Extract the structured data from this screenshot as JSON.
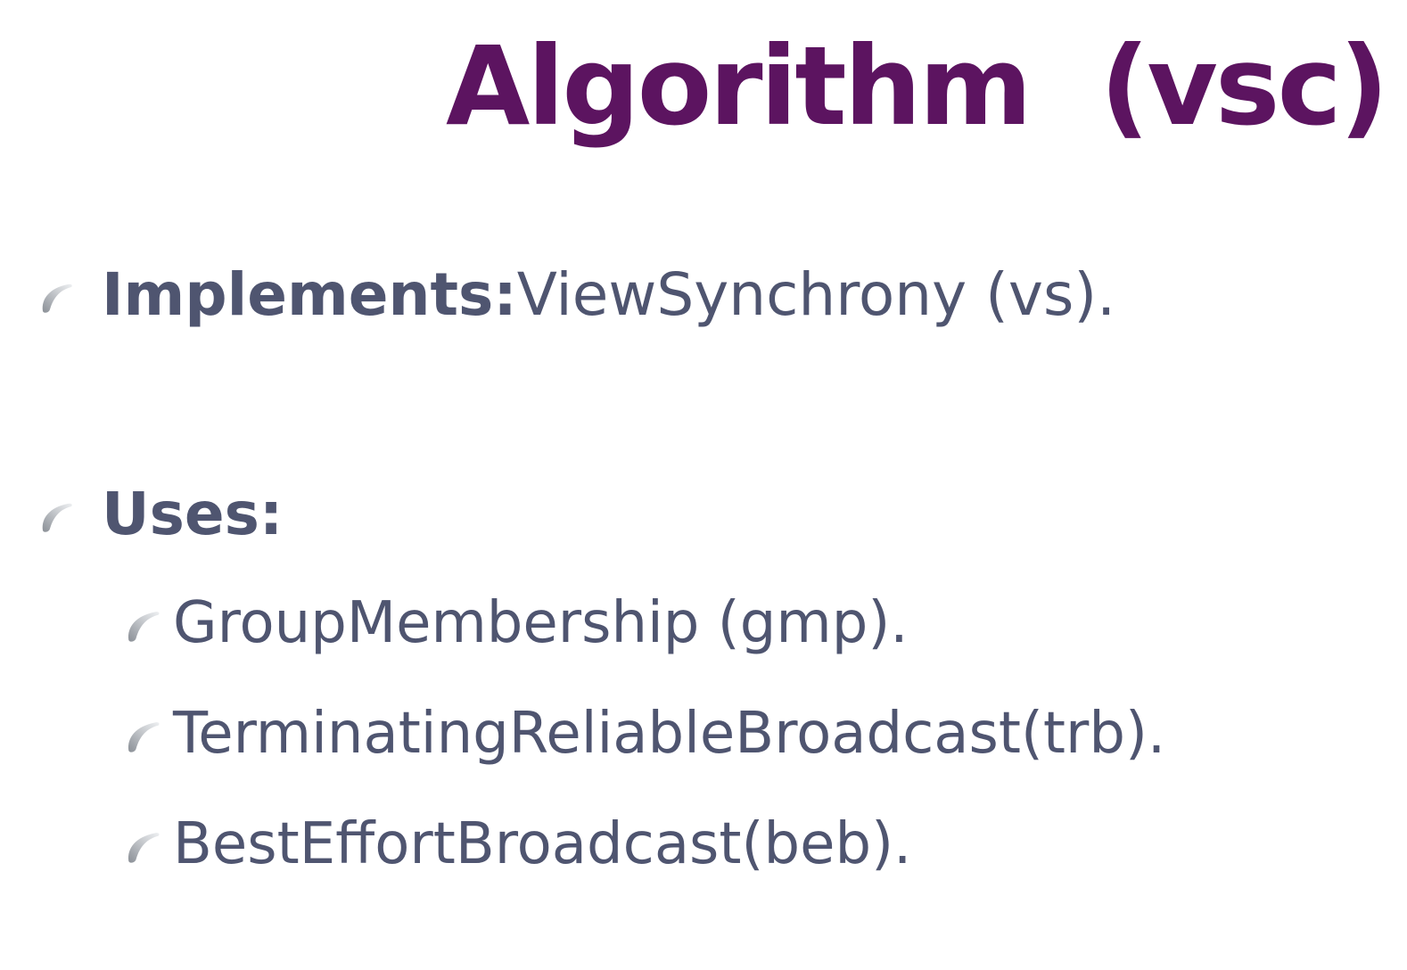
{
  "slide": {
    "title": "Algorithm  (vsc)",
    "implements": {
      "label": "Implements:",
      "text": " ViewSynchrony (vs)."
    },
    "uses": {
      "label": "Uses:",
      "items": [
        {
          "text": "GroupMembership (gmp)."
        },
        {
          "text": "TerminatingReliableBroadcast(trb)."
        },
        {
          "text": "BestEffortBroadcast(beb)."
        }
      ]
    }
  },
  "theme": {
    "title_color": "#5c1460",
    "body_color": "#4f5570"
  },
  "icons": {
    "bullet": "swoosh-bullet-icon"
  }
}
